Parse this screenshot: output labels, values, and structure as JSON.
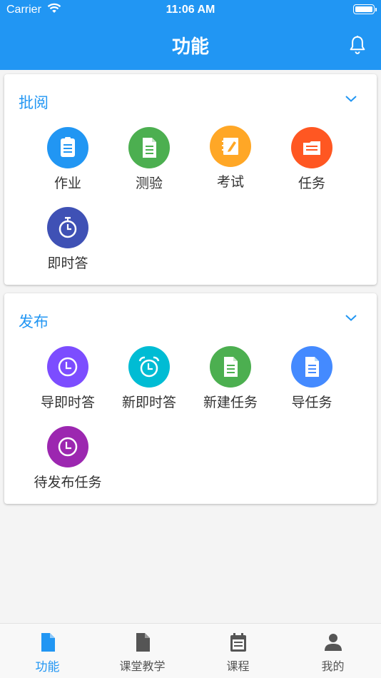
{
  "status_bar": {
    "carrier": "Carrier",
    "time": "11:06 AM"
  },
  "header": {
    "title": "功能",
    "bell_icon": "bell-icon"
  },
  "sections": [
    {
      "title": "批阅",
      "items": [
        {
          "label": "作业",
          "icon": "clipboard-icon",
          "color": "#2196f3"
        },
        {
          "label": "测验",
          "icon": "document-icon",
          "color": "#4caf50"
        },
        {
          "label": "考试",
          "icon": "pen-notebook-icon",
          "color": "#ffa726"
        },
        {
          "label": "任务",
          "icon": "folder-icon",
          "color": "#ff5722"
        },
        {
          "label": "即时答",
          "icon": "stopwatch-icon",
          "color": "#3f51b5"
        }
      ]
    },
    {
      "title": "发布",
      "items": [
        {
          "label": "导即时答",
          "icon": "clock-icon",
          "color": "#7c4dff"
        },
        {
          "label": "新即时答",
          "icon": "alarm-clock-icon",
          "color": "#00bcd4"
        },
        {
          "label": "新建任务",
          "icon": "document-icon",
          "color": "#4caf50"
        },
        {
          "label": "导任务",
          "icon": "document-icon",
          "color": "#448aff"
        },
        {
          "label": "待发布任务",
          "icon": "clock-icon",
          "color": "#9c27b0"
        }
      ]
    }
  ],
  "tabbar": {
    "tabs": [
      {
        "label": "功能",
        "icon": "file-icon",
        "active": true
      },
      {
        "label": "课堂教学",
        "icon": "file-icon",
        "active": false
      },
      {
        "label": "课程",
        "icon": "calendar-icon",
        "active": false
      },
      {
        "label": "我的",
        "icon": "person-icon",
        "active": false
      }
    ],
    "active_color": "#2196f3",
    "inactive_color": "#555555"
  }
}
